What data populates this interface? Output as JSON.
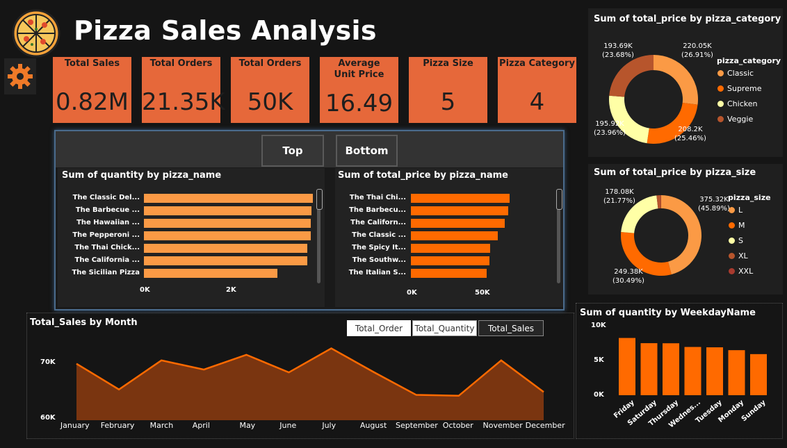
{
  "header": {
    "title": "Pizza Sales Analysis",
    "logo_icon": "pizza-icon",
    "settings_icon": "gear-icon"
  },
  "kpis": [
    {
      "label": "Total Sales",
      "value": "0.82M"
    },
    {
      "label": "Total Orders",
      "value": "21.35K"
    },
    {
      "label": "Total Orders",
      "value": "50K"
    },
    {
      "label": "Average Unit Price",
      "value": "16.49"
    },
    {
      "label": "Pizza Size",
      "value": "5"
    },
    {
      "label": "Pizza Category",
      "value": "4"
    }
  ],
  "top_bottom": {
    "top_label": "Top",
    "bottom_label": "Bottom"
  },
  "qty_by_name": {
    "title": "Sum of quantity by pizza_name",
    "ticks": [
      "0K",
      "2K"
    ],
    "xlim": [
      0,
      2500
    ],
    "names": [
      "The Classic Del...",
      "The Barbecue ...",
      "The Hawaiian ...",
      "The Pepperoni ...",
      "The Thai Chick...",
      "The California ...",
      "The Sicilian Pizza"
    ],
    "values": [
      2453,
      2432,
      2422,
      2418,
      2371,
      2370,
      1938
    ],
    "color": "#fb9a45"
  },
  "price_by_name": {
    "title": "Sum of total_price by pizza_name",
    "ticks": [
      "0K",
      "50K"
    ],
    "xlim": [
      0,
      60000
    ],
    "names": [
      "The Thai Chi...",
      "The Barbecu...",
      "The Californ...",
      "The Classic ...",
      "The Spicy It...",
      "The Southw...",
      "The Italian S..."
    ],
    "values": [
      43434,
      42768,
      41410,
      38180,
      34831,
      34706,
      33476
    ],
    "color": "#ff6a00"
  },
  "category_donut": {
    "title": "Sum of total_price by pizza_category",
    "legend_title": "pizza_category",
    "items": [
      {
        "name": "Classic",
        "value": 220.05,
        "label": "220.05K",
        "pct": "(26.91%)",
        "color": "#fb9a45"
      },
      {
        "name": "Supreme",
        "value": 208.2,
        "label": "208.2K",
        "pct": "(25.46%)",
        "color": "#ff6a00"
      },
      {
        "name": "Chicken",
        "value": 195.92,
        "label": "195.92K",
        "pct": "(23.96%)",
        "color": "#ffffa6"
      },
      {
        "name": "Veggie",
        "value": 193.69,
        "label": "193.69K",
        "pct": "(23.68%)",
        "color": "#b7552c"
      }
    ]
  },
  "size_donut": {
    "title": "Sum of total_price by pizza_size",
    "legend_title": "pizza_size",
    "items": [
      {
        "name": "L",
        "value": 375.32,
        "label": "375.32K",
        "pct": "(45.89%)",
        "color": "#fb9a45"
      },
      {
        "name": "M",
        "value": 249.38,
        "label": "249.38K",
        "pct": "(30.49%)",
        "color": "#ff6a00"
      },
      {
        "name": "S",
        "value": 178.08,
        "label": "178.08K",
        "pct": "(21.77%)",
        "color": "#ffffa6"
      },
      {
        "name": "XL",
        "value": 14.08,
        "label": "",
        "pct": "",
        "color": "#b7552c"
      },
      {
        "name": "XXL",
        "value": 1.0,
        "label": "",
        "pct": "",
        "color": "#a83a2e"
      }
    ]
  },
  "month_chart": {
    "title": "Total_Sales by Month",
    "toggles": [
      "Total_Order",
      "Total_Quantity",
      "Total_Sales"
    ],
    "active_toggle": "Total_Sales",
    "yticks": [
      "70K",
      "60K"
    ],
    "ylim": [
      60000,
      72000
    ],
    "months": [
      "January",
      "February",
      "March",
      "April",
      "May",
      "June",
      "July",
      "August",
      "September",
      "October",
      "November",
      "December"
    ],
    "values": [
      69793,
      65160,
      70397,
      68737,
      71403,
      68230,
      72558,
      68278,
      64180,
      64028,
      70395,
      64701
    ],
    "line_color": "#ff6a00",
    "fill_color": "#7a3510"
  },
  "weekday_chart": {
    "title": "Sum of quantity by WeekdayName",
    "yticks": [
      "10K",
      "5K",
      "0K"
    ],
    "ylim": [
      0,
      10000
    ],
    "days": [
      "Friday",
      "Saturday",
      "Thursday",
      "Wednes...",
      "Tuesday",
      "Monday",
      "Sunday"
    ],
    "values": [
      8242,
      7493,
      7478,
      6946,
      6895,
      6485,
      5917
    ],
    "color": "#ff6a00"
  }
}
